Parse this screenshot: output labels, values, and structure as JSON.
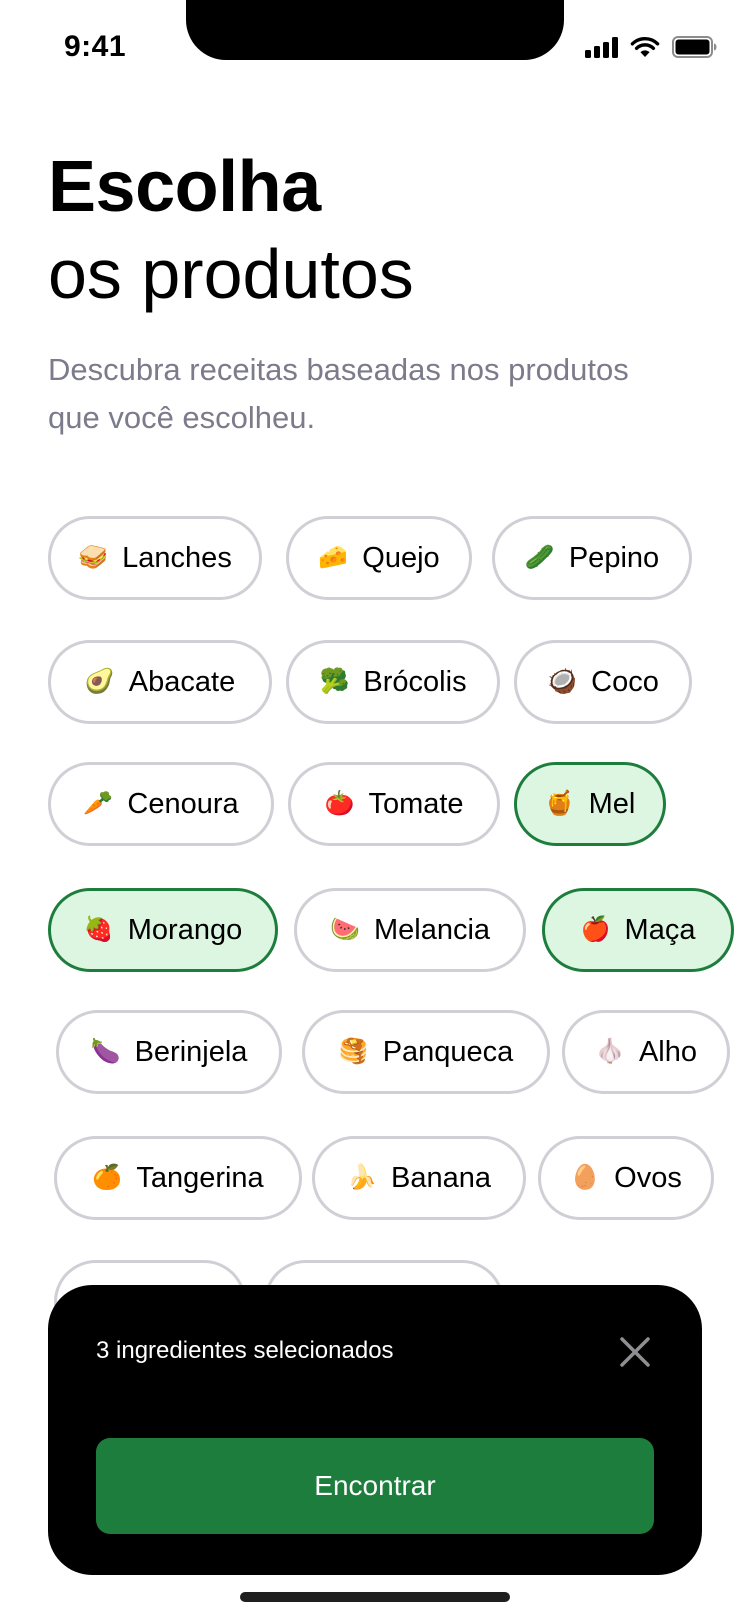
{
  "status_bar": {
    "time": "9:41"
  },
  "header": {
    "title_bold": "Escolha",
    "title_light": "os produtos",
    "subtitle": "Descubra receitas baseadas nos produtos que você escolheu."
  },
  "chips": [
    {
      "emoji": "🥪",
      "label": "Lanches",
      "selected": false
    },
    {
      "emoji": "🧀",
      "label": "Quejo",
      "selected": false
    },
    {
      "emoji": "🥒",
      "label": "Pepino",
      "selected": false
    },
    {
      "emoji": "🥑",
      "label": "Abacate",
      "selected": false
    },
    {
      "emoji": "🥦",
      "label": "Brócolis",
      "selected": false
    },
    {
      "emoji": "🥥",
      "label": "Coco",
      "selected": false
    },
    {
      "emoji": "🥕",
      "label": "Cenoura",
      "selected": false
    },
    {
      "emoji": "🍅",
      "label": "Tomate",
      "selected": false
    },
    {
      "emoji": "🍯",
      "label": "Mel",
      "selected": true
    },
    {
      "emoji": "🍓",
      "label": "Morango",
      "selected": true
    },
    {
      "emoji": "🍉",
      "label": "Melancia",
      "selected": false
    },
    {
      "emoji": "🍎",
      "label": "Maça",
      "selected": true
    },
    {
      "emoji": "🍆",
      "label": "Berinjela",
      "selected": false
    },
    {
      "emoji": "🥞",
      "label": "Panqueca",
      "selected": false
    },
    {
      "emoji": "🧄",
      "label": "Alho",
      "selected": false
    },
    {
      "emoji": "🍊",
      "label": "Tangerina",
      "selected": false
    },
    {
      "emoji": "🍌",
      "label": "Banana",
      "selected": false
    },
    {
      "emoji": "🥚",
      "label": "Ovos",
      "selected": false
    }
  ],
  "selection_sheet": {
    "count_label": "3 ingredientes selecionados",
    "close_icon": "close-icon",
    "action_label": "Encontrar"
  },
  "colors": {
    "accent": "#1d7d3c",
    "selected_chip_bg": "#dcf6e2",
    "chip_border": "#cfcfd6",
    "subtitle_text": "#7c7b8b"
  }
}
